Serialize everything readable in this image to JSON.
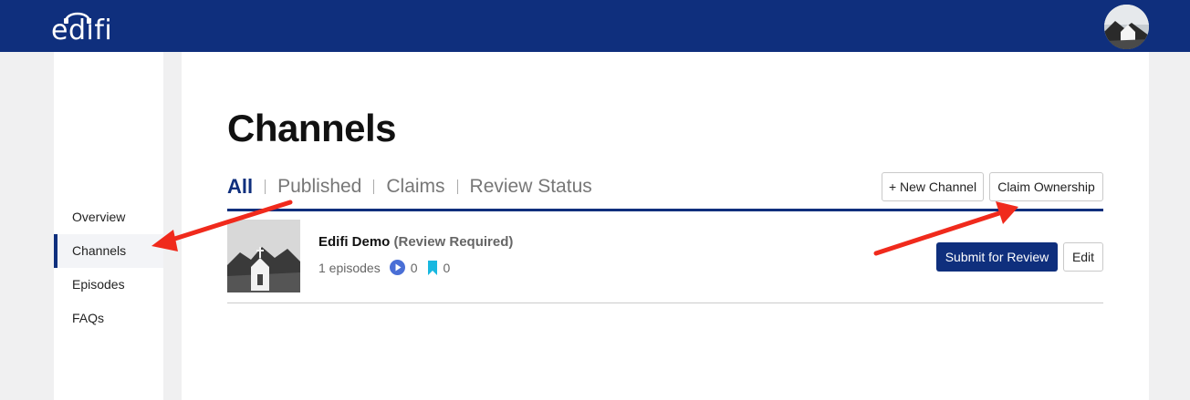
{
  "header": {
    "logo_text": "edifi",
    "brand_color": "#0f2f7d"
  },
  "sidebar": {
    "items": [
      {
        "label": "Overview"
      },
      {
        "label": "Channels",
        "active": true
      },
      {
        "label": "Episodes"
      },
      {
        "label": "FAQs"
      }
    ]
  },
  "main": {
    "title": "Channels",
    "tabs": [
      {
        "label": "All",
        "active": true
      },
      {
        "label": "Published"
      },
      {
        "label": "Claims"
      },
      {
        "label": "Review Status"
      }
    ],
    "new_channel_label": "+ New Channel",
    "claim_ownership_label": "Claim Ownership",
    "channel": {
      "name": "Edifi Demo",
      "status": "(Review Required)",
      "episodes": "1 episodes",
      "plays": "0",
      "bookmarks": "0",
      "submit_label": "Submit for Review",
      "edit_label": "Edit"
    }
  },
  "icons": {
    "play": "play-circle-icon",
    "bookmark": "bookmark-icon"
  },
  "colors": {
    "play_icon": "#4a6fd6",
    "bookmark_icon": "#18b8e0",
    "annotation_arrow": "#f02a1c"
  }
}
